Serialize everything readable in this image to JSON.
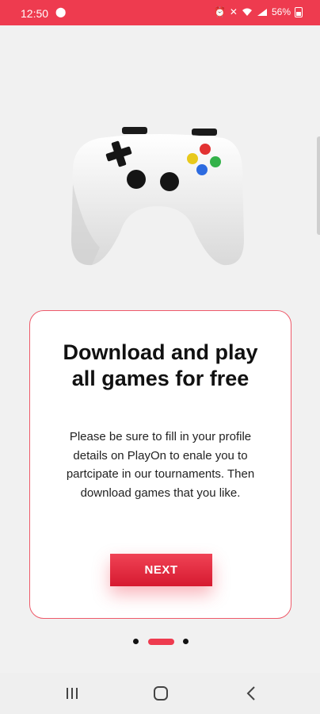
{
  "status_bar": {
    "time": "12:50",
    "battery_percent": "56%"
  },
  "onboarding": {
    "title": "Download and play all games for free",
    "body": "Please be sure to fill in your profile details on PlayOn to enale you to partcipate in our tournaments. Then download games that you like.",
    "next_label": "NEXT",
    "page_index": 2,
    "page_count": 3
  },
  "colors": {
    "accent": "#ee3b4f",
    "background": "#f1f1f1"
  },
  "icons": [
    "game-controller-illustration",
    "recents-icon",
    "home-icon",
    "back-icon"
  ]
}
